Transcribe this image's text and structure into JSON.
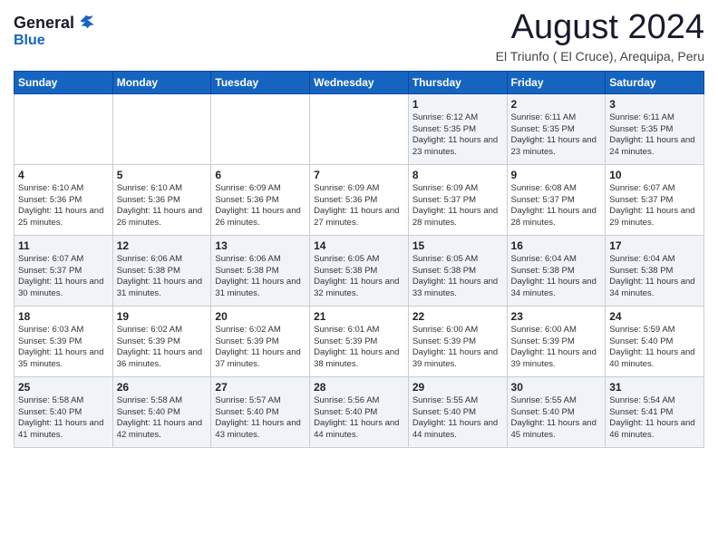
{
  "header": {
    "logo_general": "General",
    "logo_blue": "Blue",
    "title": "August 2024",
    "location": "El Triunfo ( El Cruce), Arequipa, Peru"
  },
  "calendar": {
    "days_of_week": [
      "Sunday",
      "Monday",
      "Tuesday",
      "Wednesday",
      "Thursday",
      "Friday",
      "Saturday"
    ],
    "weeks": [
      [
        {
          "day": "",
          "content": ""
        },
        {
          "day": "",
          "content": ""
        },
        {
          "day": "",
          "content": ""
        },
        {
          "day": "",
          "content": ""
        },
        {
          "day": "1",
          "content": "Sunrise: 6:12 AM\nSunset: 5:35 PM\nDaylight: 11 hours and 23 minutes."
        },
        {
          "day": "2",
          "content": "Sunrise: 6:11 AM\nSunset: 5:35 PM\nDaylight: 11 hours and 23 minutes."
        },
        {
          "day": "3",
          "content": "Sunrise: 6:11 AM\nSunset: 5:35 PM\nDaylight: 11 hours and 24 minutes."
        }
      ],
      [
        {
          "day": "4",
          "content": "Sunrise: 6:10 AM\nSunset: 5:36 PM\nDaylight: 11 hours and 25 minutes."
        },
        {
          "day": "5",
          "content": "Sunrise: 6:10 AM\nSunset: 5:36 PM\nDaylight: 11 hours and 26 minutes."
        },
        {
          "day": "6",
          "content": "Sunrise: 6:09 AM\nSunset: 5:36 PM\nDaylight: 11 hours and 26 minutes."
        },
        {
          "day": "7",
          "content": "Sunrise: 6:09 AM\nSunset: 5:36 PM\nDaylight: 11 hours and 27 minutes."
        },
        {
          "day": "8",
          "content": "Sunrise: 6:09 AM\nSunset: 5:37 PM\nDaylight: 11 hours and 28 minutes."
        },
        {
          "day": "9",
          "content": "Sunrise: 6:08 AM\nSunset: 5:37 PM\nDaylight: 11 hours and 28 minutes."
        },
        {
          "day": "10",
          "content": "Sunrise: 6:07 AM\nSunset: 5:37 PM\nDaylight: 11 hours and 29 minutes."
        }
      ],
      [
        {
          "day": "11",
          "content": "Sunrise: 6:07 AM\nSunset: 5:37 PM\nDaylight: 11 hours and 30 minutes."
        },
        {
          "day": "12",
          "content": "Sunrise: 6:06 AM\nSunset: 5:38 PM\nDaylight: 11 hours and 31 minutes."
        },
        {
          "day": "13",
          "content": "Sunrise: 6:06 AM\nSunset: 5:38 PM\nDaylight: 11 hours and 31 minutes."
        },
        {
          "day": "14",
          "content": "Sunrise: 6:05 AM\nSunset: 5:38 PM\nDaylight: 11 hours and 32 minutes."
        },
        {
          "day": "15",
          "content": "Sunrise: 6:05 AM\nSunset: 5:38 PM\nDaylight: 11 hours and 33 minutes."
        },
        {
          "day": "16",
          "content": "Sunrise: 6:04 AM\nSunset: 5:38 PM\nDaylight: 11 hours and 34 minutes."
        },
        {
          "day": "17",
          "content": "Sunrise: 6:04 AM\nSunset: 5:38 PM\nDaylight: 11 hours and 34 minutes."
        }
      ],
      [
        {
          "day": "18",
          "content": "Sunrise: 6:03 AM\nSunset: 5:39 PM\nDaylight: 11 hours and 35 minutes."
        },
        {
          "day": "19",
          "content": "Sunrise: 6:02 AM\nSunset: 5:39 PM\nDaylight: 11 hours and 36 minutes."
        },
        {
          "day": "20",
          "content": "Sunrise: 6:02 AM\nSunset: 5:39 PM\nDaylight: 11 hours and 37 minutes."
        },
        {
          "day": "21",
          "content": "Sunrise: 6:01 AM\nSunset: 5:39 PM\nDaylight: 11 hours and 38 minutes."
        },
        {
          "day": "22",
          "content": "Sunrise: 6:00 AM\nSunset: 5:39 PM\nDaylight: 11 hours and 39 minutes."
        },
        {
          "day": "23",
          "content": "Sunrise: 6:00 AM\nSunset: 5:39 PM\nDaylight: 11 hours and 39 minutes."
        },
        {
          "day": "24",
          "content": "Sunrise: 5:59 AM\nSunset: 5:40 PM\nDaylight: 11 hours and 40 minutes."
        }
      ],
      [
        {
          "day": "25",
          "content": "Sunrise: 5:58 AM\nSunset: 5:40 PM\nDaylight: 11 hours and 41 minutes."
        },
        {
          "day": "26",
          "content": "Sunrise: 5:58 AM\nSunset: 5:40 PM\nDaylight: 11 hours and 42 minutes."
        },
        {
          "day": "27",
          "content": "Sunrise: 5:57 AM\nSunset: 5:40 PM\nDaylight: 11 hours and 43 minutes."
        },
        {
          "day": "28",
          "content": "Sunrise: 5:56 AM\nSunset: 5:40 PM\nDaylight: 11 hours and 44 minutes."
        },
        {
          "day": "29",
          "content": "Sunrise: 5:55 AM\nSunset: 5:40 PM\nDaylight: 11 hours and 44 minutes."
        },
        {
          "day": "30",
          "content": "Sunrise: 5:55 AM\nSunset: 5:40 PM\nDaylight: 11 hours and 45 minutes."
        },
        {
          "day": "31",
          "content": "Sunrise: 5:54 AM\nSunset: 5:41 PM\nDaylight: 11 hours and 46 minutes."
        }
      ]
    ]
  }
}
